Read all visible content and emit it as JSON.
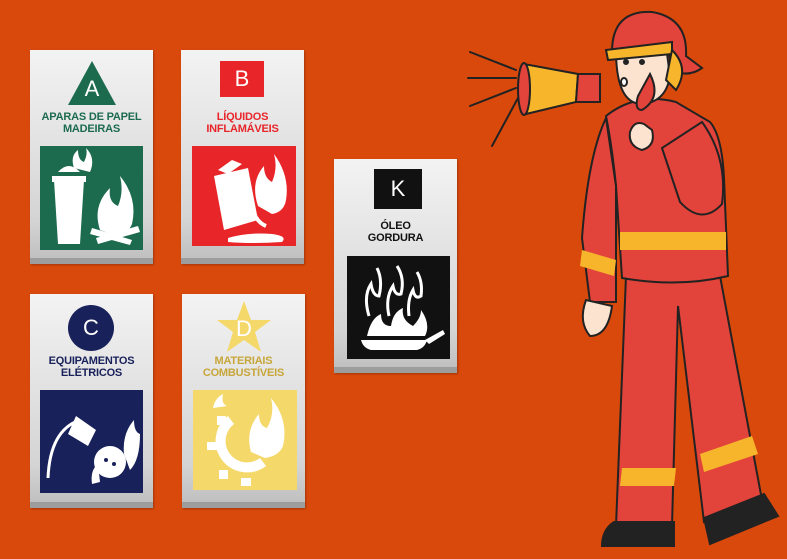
{
  "classes": [
    {
      "id": "A",
      "letter": "A",
      "label_line1": "APARAS DE PAPEL",
      "label_line2": "MADEIRAS",
      "color": "#1c6b4f",
      "icon": "trash-bin-fire-icon"
    },
    {
      "id": "B",
      "letter": "B",
      "label_line1": "LÍQUIDOS",
      "label_line2": "INFLAMÁVEIS",
      "color": "#e8262a",
      "icon": "fuel-can-fire-icon"
    },
    {
      "id": "K",
      "letter": "K",
      "label_line1": "ÓLEO",
      "label_line2": "GORDURA",
      "color": "#111111",
      "icon": "frying-pan-fire-icon"
    },
    {
      "id": "C",
      "letter": "C",
      "label_line1": "EQUIPAMENTOS",
      "label_line2": "ELÉTRICOS",
      "color": "#18215a",
      "icon": "electric-plug-fire-icon"
    },
    {
      "id": "D",
      "letter": "D",
      "label_line1": "MATERIAIS",
      "label_line2": "COMBUSTÍVEIS",
      "color": "#f5d86a",
      "icon": "gear-fire-icon"
    }
  ],
  "figure": {
    "icon": "firefighter-megaphone-icon"
  }
}
